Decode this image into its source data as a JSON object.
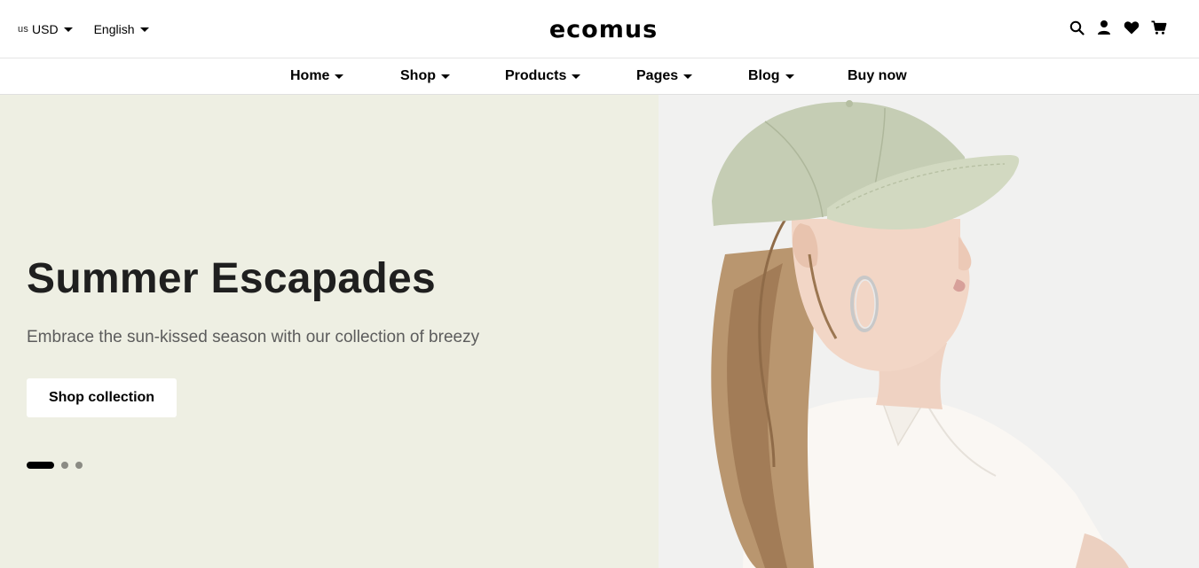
{
  "header": {
    "currency": {
      "flag": "us",
      "label": "USD"
    },
    "language": {
      "label": "English"
    },
    "logo": "ecomus",
    "icons": [
      "search-icon",
      "account-icon",
      "wishlist-icon",
      "cart-icon"
    ]
  },
  "nav": {
    "items": [
      {
        "label": "Home",
        "has_dropdown": true
      },
      {
        "label": "Shop",
        "has_dropdown": true
      },
      {
        "label": "Products",
        "has_dropdown": true
      },
      {
        "label": "Pages",
        "has_dropdown": true
      },
      {
        "label": "Blog",
        "has_dropdown": true
      },
      {
        "label": "Buy now",
        "has_dropdown": false
      }
    ]
  },
  "hero": {
    "title": "Summer Escapades",
    "subtitle": "Embrace the sun-kissed season with our collection of breezy",
    "cta_label": "Shop collection",
    "slides": {
      "count": 3,
      "active": 0
    }
  },
  "colors": {
    "hero_bg": "#eeefe3",
    "cap_color": "#c5cdb4",
    "accent": "#000000"
  }
}
